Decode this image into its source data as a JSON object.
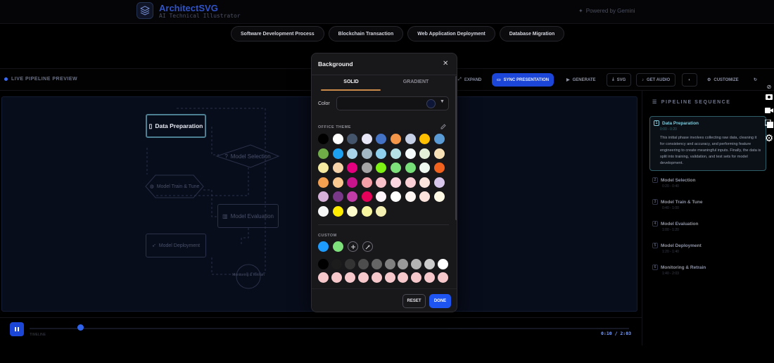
{
  "app": {
    "title": "ArchitectSVG",
    "subtitle": "AI Technical Illustrator",
    "powered_by": "Powered by Gemini"
  },
  "presets": [
    "Software Development Process",
    "Blockchain Transaction",
    "Web Application Deployment",
    "Database Migration"
  ],
  "toolbar": {
    "live_label": "LIVE PIPELINE PREVIEW",
    "expand": "EXPAND",
    "sync": "SYNC PRESENTATION",
    "generate": "GENERATE",
    "svg": "SVG",
    "get_audio": "GET AUDIO",
    "customize": "CUSTOMIZE"
  },
  "canvas": {
    "nodes": [
      "Data Preparation",
      "Model Selection",
      "Model Train & Tune",
      "Model Evaluation",
      "Model Deployment",
      "Monitoring & Retrain"
    ]
  },
  "timeline": {
    "label": "TIMELINE",
    "time": "0:10 / 2:03",
    "progress": 0.085
  },
  "sidebar": {
    "title": "PIPELINE SEQUENCE",
    "steps": [
      {
        "num": "1",
        "title": "Data Preparation",
        "time": "0:00 - 0:20",
        "desc": "This initial phase involves collecting raw data, cleaning it for consistency and accuracy, and performing feature engineering to create meaningful inputs. Finally, the data is split into training, validation, and test sets for model development."
      },
      {
        "num": "2",
        "title": "Model Selection",
        "time": "0:20 - 0:40"
      },
      {
        "num": "3",
        "title": "Model Train & Tune",
        "time": "0:40 - 1:00"
      },
      {
        "num": "4",
        "title": "Model Evaluation",
        "time": "1:00 - 1:20"
      },
      {
        "num": "5",
        "title": "Model Deployment",
        "time": "1:20 - 1:40"
      },
      {
        "num": "6",
        "title": "Monitoring & Retrain",
        "time": "1:40 - 2:03"
      }
    ]
  },
  "modal": {
    "title": "Background",
    "tabs": [
      "SOLID",
      "GRADIENT"
    ],
    "active_tab": "SOLID",
    "color_label": "Color",
    "selected_color": "#0e1638",
    "office_theme_label": "OFFICE THEME",
    "custom_label": "CUSTOM",
    "reset": "RESET",
    "done": "DONE",
    "office_colors": [
      "#000000",
      "#ffffff",
      "#44546a",
      "#e7e6f6",
      "#4472c4",
      "#f4964a",
      "#c5cfe6",
      "#ffc000",
      "#5b9bd5",
      "#70ad47",
      "#1ea0f0",
      "#a9d3e8",
      "#a2b6c4",
      "#8ed0ee",
      "#b4e0e6",
      "#f5fafb",
      "#e4efd8",
      "#f8e0b6",
      "#f6eaa0",
      "#f5d2a8",
      "#e5007f",
      "#a5a5a5",
      "#7ef214",
      "#7ee07a",
      "#78e078",
      "#eef8ee",
      "#f0621e",
      "#f4a050",
      "#f8c890",
      "#c8148c",
      "#f4a0a8",
      "#f8c0c8",
      "#fad6e0",
      "#fad0d6",
      "#fbe4dc",
      "#d8c6ea",
      "#d6b0d8",
      "#7a3888",
      "#c23ca8",
      "#e5005a",
      "#fff4fa",
      "#ffffff",
      "#fff6f4",
      "#fce4dc",
      "#fff8e4",
      "#f6f6f6",
      "#ffec00",
      "#fdfbcc",
      "#f8f5a0",
      "#f4f0b4"
    ],
    "custom_colors": [
      "#1e9bff",
      "#7ee07a"
    ],
    "gray_colors": [
      "#000000",
      "#1c1c1c",
      "#333333",
      "#4d4d4d",
      "#666666",
      "#808080",
      "#999999",
      "#b3b3b3",
      "#cccccc",
      "#ffffff"
    ],
    "pink_colors": [
      "#f6c8cc",
      "#f6c8cc",
      "#f6c8cc",
      "#f6c8cc",
      "#f6c8cc",
      "#f6c8cc",
      "#f6c8cc",
      "#f6c8cc",
      "#f6c8cc",
      "#f6c8cc"
    ]
  }
}
